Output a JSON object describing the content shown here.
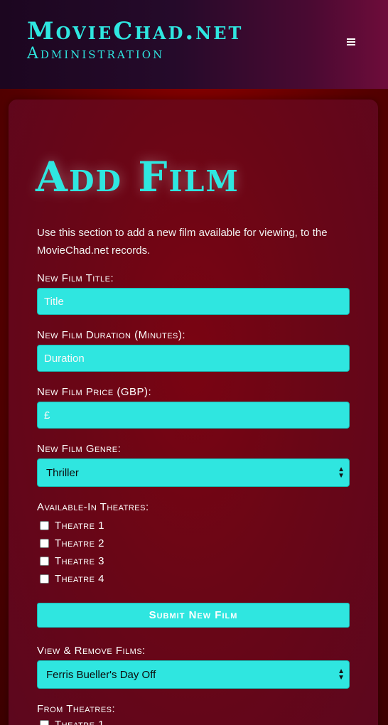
{
  "navbar": {
    "brand_title": "MovieChad.net",
    "brand_subtitle": "Administration",
    "menu_icon": "hamburger-icon"
  },
  "main": {
    "title": "Add Film",
    "intro": "Use this section to add a new film available for viewing, to the MovieChad.net records."
  },
  "form": {
    "title_label": "New Film Title:",
    "title_placeholder": "Title",
    "duration_label": "New Film Duration (Minutes):",
    "duration_placeholder": "Duration",
    "price_label": "New Film Price (GBP):",
    "price_placeholder": "£",
    "genre_label": "New Film Genre:",
    "genre_selected": "Thriller",
    "theatres_label": "Available-In Theatres:",
    "theatres": [
      "Theatre 1",
      "Theatre 2",
      "Theatre 3",
      "Theatre 4"
    ],
    "submit_label": "Submit New Film"
  },
  "remove": {
    "label": "View & Remove Films:",
    "selected_film": "Ferris Bueller's Day Off",
    "from_label": "From Theatres:",
    "theatres": [
      "Theatre 1"
    ]
  },
  "colors": {
    "accent": "#2fe6e0",
    "background": "#6a0616",
    "navbar": "#250a2a"
  }
}
